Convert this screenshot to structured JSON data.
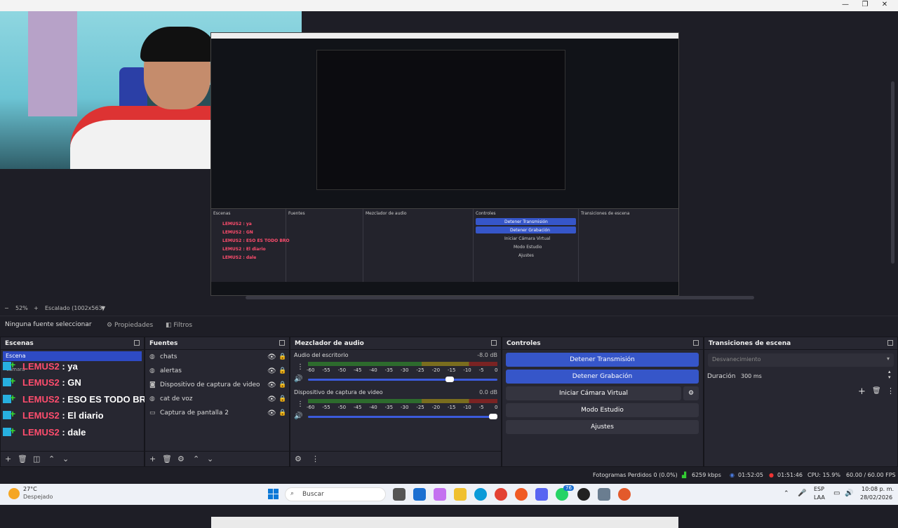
{
  "preview": {
    "zoom": "52%",
    "scale_label": "Escalado (1002x563)"
  },
  "nested_preview": {
    "panels": [
      "Escenas",
      "Fuentes",
      "Mezclador de audio",
      "Controles",
      "Transiciones de escena"
    ],
    "scenes": [
      "LEMUS2 : ya",
      "LEMUS2 : GN",
      "LEMUS2 : ESO ES TODO BRO",
      "LEMUS2 : El diario",
      "LEMUS2 : dale"
    ],
    "controls": [
      "Detener Transmisión",
      "Detener Grabación",
      "Iniciar Cámara Virtual",
      "Modo Estudio",
      "Ajustes"
    ]
  },
  "source_bar": {
    "label": "Ninguna fuente seleccionar",
    "properties": "Propiedades",
    "filters": "Filtros"
  },
  "scenes": {
    "title": "Escenas",
    "selected_label": "Escena",
    "camera_label": "cámara",
    "items": [
      {
        "prefix": "LEMUS2",
        "suffix": " : ya"
      },
      {
        "prefix": "LEMUS2",
        "suffix": " : GN"
      },
      {
        "prefix": "LEMUS2",
        "suffix": " : ESO ES TODO BRO"
      },
      {
        "prefix": "LEMUS2",
        "suffix": " : El diario"
      },
      {
        "prefix": "LEMUS2",
        "suffix": " : dale"
      }
    ]
  },
  "sources": {
    "title": "Fuentes",
    "items": [
      "chats",
      "alertas",
      "Dispositivo de captura de video",
      "cat de voz",
      "Captura de pantalla 2"
    ]
  },
  "mixer": {
    "title": "Mezclador de audio",
    "channels": [
      {
        "name": "Audio del escritorio",
        "db": "-8.0 dB",
        "level": 0.76
      },
      {
        "name": "Dispositivo de captura de video",
        "db": "0.0 dB",
        "level": 1.0
      }
    ],
    "ticks": [
      "-60",
      "-55",
      "-50",
      "-45",
      "-40",
      "-35",
      "-30",
      "-25",
      "-20",
      "-15",
      "-10",
      "-5",
      "0"
    ]
  },
  "controls": {
    "title": "Controles",
    "stop_stream": "Detener Transmisión",
    "stop_record": "Detener Grabación",
    "virtual_cam": "Iniciar Cámara Virtual",
    "studio_mode": "Modo Estudio",
    "settings": "Ajustes"
  },
  "transitions": {
    "title": "Transiciones de escena",
    "transition": "Desvanecimiento",
    "duration_label": "Duración",
    "duration_value": "300 ms"
  },
  "status": {
    "dropped": "Fotogramas Perdidos 0 (0.0%)",
    "bitrate": "6259 kbps",
    "stream_time": "01:52:05",
    "record_time": "01:51:46",
    "cpu": "CPU: 15.9%",
    "fps": "60.00 / 60.00 FPS"
  },
  "taskbar": {
    "weather_temp": "27°C",
    "weather_desc": "Despejado",
    "search_placeholder": "Buscar",
    "lang_top": "ESP",
    "lang_bottom": "LAA",
    "time": "10:08 p. m.",
    "date": "28/02/2026",
    "badge": "76"
  },
  "colors": {
    "accent": "#3656c9",
    "scene_red": "#ff4d6d",
    "panel": "#272731",
    "background": "#1e1e26"
  }
}
